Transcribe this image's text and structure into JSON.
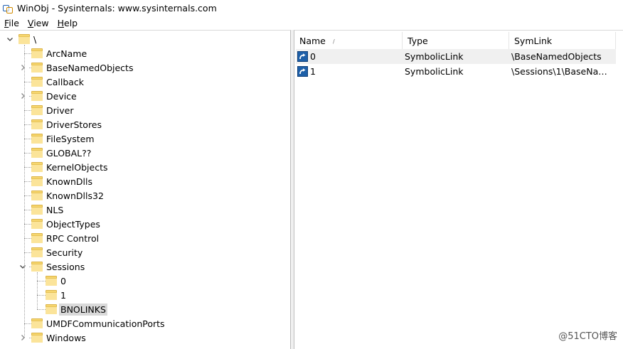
{
  "window": {
    "title": "WinObj - Sysinternals: www.sysinternals.com"
  },
  "menu": [
    {
      "label": "File",
      "accel": "F",
      "rest": "ile"
    },
    {
      "label": "View",
      "accel": "V",
      "rest": "iew"
    },
    {
      "label": "Help",
      "accel": "H",
      "rest": "elp"
    }
  ],
  "tree": {
    "root": "\\",
    "items": [
      {
        "label": "ArcName",
        "expandable": false
      },
      {
        "label": "BaseNamedObjects",
        "expandable": true
      },
      {
        "label": "Callback",
        "expandable": false
      },
      {
        "label": "Device",
        "expandable": true
      },
      {
        "label": "Driver",
        "expandable": false
      },
      {
        "label": "DriverStores",
        "expandable": false
      },
      {
        "label": "FileSystem",
        "expandable": false
      },
      {
        "label": "GLOBAL??",
        "expandable": false
      },
      {
        "label": "KernelObjects",
        "expandable": false
      },
      {
        "label": "KnownDlls",
        "expandable": false
      },
      {
        "label": "KnownDlls32",
        "expandable": false
      },
      {
        "label": "NLS",
        "expandable": false
      },
      {
        "label": "ObjectTypes",
        "expandable": false
      },
      {
        "label": "RPC Control",
        "expandable": false
      },
      {
        "label": "Security",
        "expandable": false
      },
      {
        "label": "Sessions",
        "expandable": true,
        "expanded": true
      },
      {
        "label": "UMDFCommunicationPorts",
        "expandable": false
      },
      {
        "label": "Windows",
        "expandable": true
      }
    ],
    "sessions_children": [
      {
        "label": "0"
      },
      {
        "label": "1"
      },
      {
        "label": "BNOLINKS",
        "selected": true
      }
    ]
  },
  "list": {
    "columns": [
      "Name",
      "Type",
      "SymLink"
    ],
    "sort_indicator": "/",
    "rows": [
      {
        "name": "0",
        "type": "SymbolicLink",
        "symlink": "\\BaseNamedObjects",
        "selected": true
      },
      {
        "name": "1",
        "type": "SymbolicLink",
        "symlink": "\\Sessions\\1\\BaseNam..."
      }
    ]
  },
  "watermark": "@51CTO博客"
}
